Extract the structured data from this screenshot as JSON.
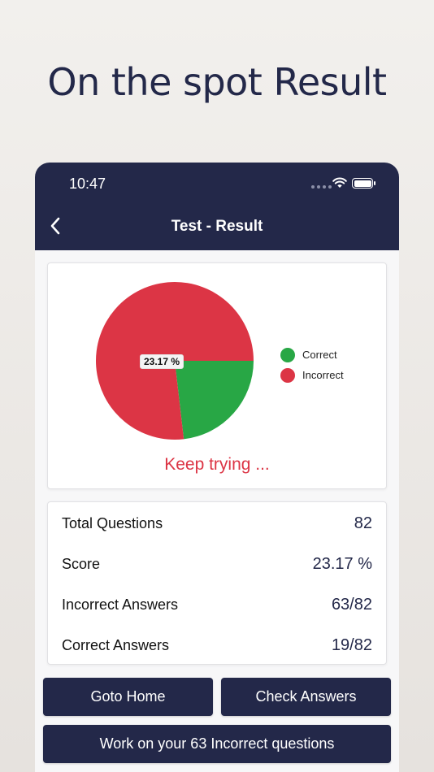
{
  "headline": "On the spot Result",
  "status_bar": {
    "time": "10:47"
  },
  "nav": {
    "title": "Test - Result"
  },
  "chart_data": {
    "type": "pie",
    "slices": [
      {
        "label": "Correct",
        "value": 23.17,
        "color": "#28a745"
      },
      {
        "label": "Incorrect",
        "value": 76.83,
        "color": "#dc3545"
      }
    ],
    "data_label": "23.17 %",
    "legend_position": "right"
  },
  "legend": [
    {
      "label": "Correct",
      "color": "#28a745"
    },
    {
      "label": "Incorrect",
      "color": "#dc3545"
    }
  ],
  "feedback": "Keep trying ...",
  "stats": [
    {
      "label": "Total Questions",
      "value": "82"
    },
    {
      "label": "Score",
      "value": "23.17 %"
    },
    {
      "label": "Incorrect Answers",
      "value": "63/82"
    },
    {
      "label": "Correct Answers",
      "value": "19/82"
    }
  ],
  "buttons": {
    "home": "Goto Home",
    "check": "Check Answers",
    "work": "Work on your 63 Incorrect questions"
  },
  "colors": {
    "navy": "#232849",
    "correct": "#28a745",
    "incorrect": "#dc3545"
  }
}
